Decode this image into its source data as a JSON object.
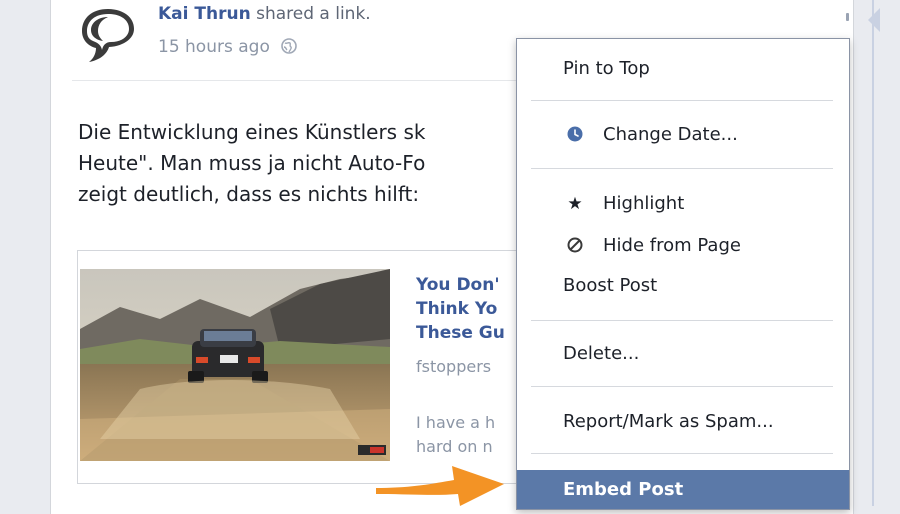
{
  "post": {
    "author": "Kai Thrun",
    "action": " shared a link.",
    "timestamp": "15 hours ago",
    "body_lines": [
      "Die Entwicklung eines Künstlers sk",
      "Heute\". Man muss ja nicht Auto-Fo",
      "zeigt deutlich, dass es nichts hilft:"
    ],
    "link": {
      "title_lines": [
        "You Don'",
        "Think Yo",
        "These Gu"
      ],
      "domain": "fstoppers",
      "description_lines": [
        "I have a h",
        "hard on n"
      ]
    }
  },
  "menu": {
    "items": [
      {
        "label": "Pin to Top"
      },
      {
        "label": "Change Date...",
        "icon": "clock-icon"
      },
      {
        "label": "Highlight",
        "icon": "star-icon"
      },
      {
        "label": "Hide from Page",
        "icon": "hide-icon"
      },
      {
        "label": "Boost Post"
      },
      {
        "label": "Delete..."
      },
      {
        "label": "Report/Mark as Spam..."
      },
      {
        "label": "Embed Post",
        "state": "highlighted"
      }
    ]
  },
  "colors": {
    "link_blue": "#3b5998",
    "menu_highlight": "#5b79a8",
    "annotation_arrow": "#f39325"
  }
}
